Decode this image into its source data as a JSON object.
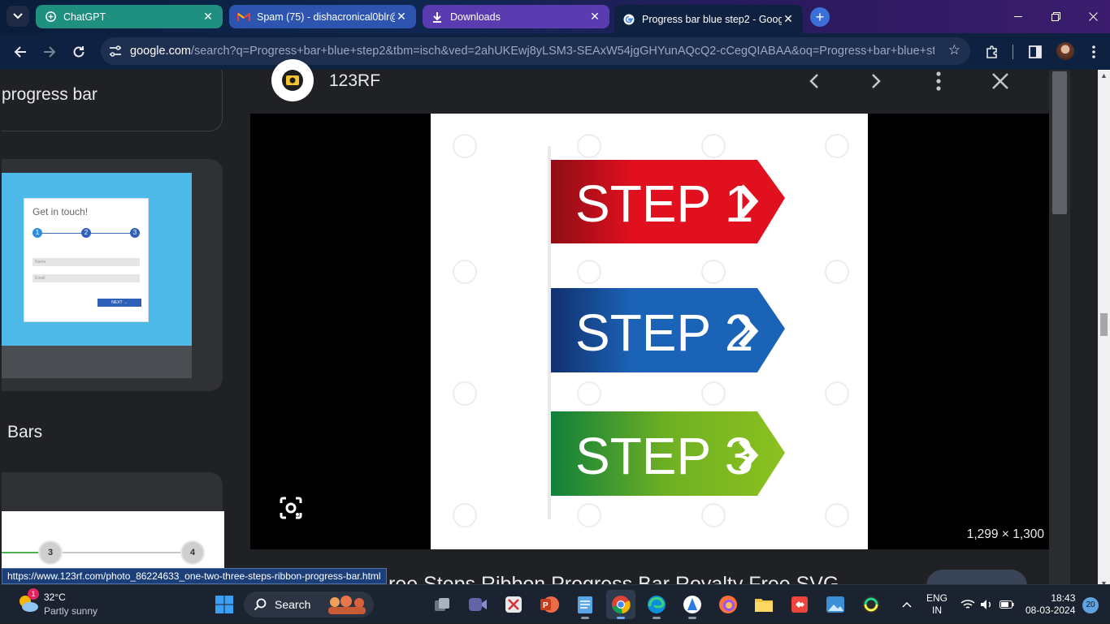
{
  "browser": {
    "tabs": [
      {
        "title": "ChatGPT",
        "icon": "chatgpt-icon"
      },
      {
        "title": "Spam (75) - dishacronical0blr@",
        "icon": "gmail-icon"
      },
      {
        "title": "Downloads",
        "icon": "download-icon"
      },
      {
        "title": "Progress bar blue step2 - Goog",
        "icon": "google-icon",
        "active": true
      }
    ],
    "url_domain": "google.com",
    "url_path": "/search?q=Progress+bar+blue+step2&tbm=isch&ved=2ahUKEwj8yLSM3-SEAxW54jgGHYunAQcQ2-cCegQIABAA&oq=Progress+bar+blue+step2..."
  },
  "results": {
    "card1_text": "progress bar",
    "thumb1": {
      "heading": "Get in touch!",
      "steps": [
        "1",
        "2",
        "3"
      ],
      "field1": "Name",
      "field2": "Email",
      "button": "NEXT →"
    },
    "card2_text": "Bars",
    "thumb2": {
      "steps": [
        "3",
        "4"
      ]
    }
  },
  "viewer": {
    "source": "123RF",
    "dimensions": "1,299 × 1,300",
    "title": "ree Steps Ribbon Progress Bar Royalty Free SVG",
    "steps": [
      {
        "label": "STEP 1",
        "color": "#e0101f"
      },
      {
        "label": "STEP 2",
        "color": "#1b63b7"
      },
      {
        "label": "STEP 3",
        "color": "#8cc11f"
      }
    ]
  },
  "status_url": "https://www.123rf.com/photo_86224633_one-two-three-steps-ribbon-progress-bar.html",
  "taskbar": {
    "temperature": "32°C",
    "weather": "Partly sunny",
    "weather_badge": "1",
    "search_label": "Search",
    "lang_line1": "ENG",
    "lang_line2": "IN",
    "time": "18:43",
    "date": "08-03-2024",
    "notification_count": "20"
  }
}
